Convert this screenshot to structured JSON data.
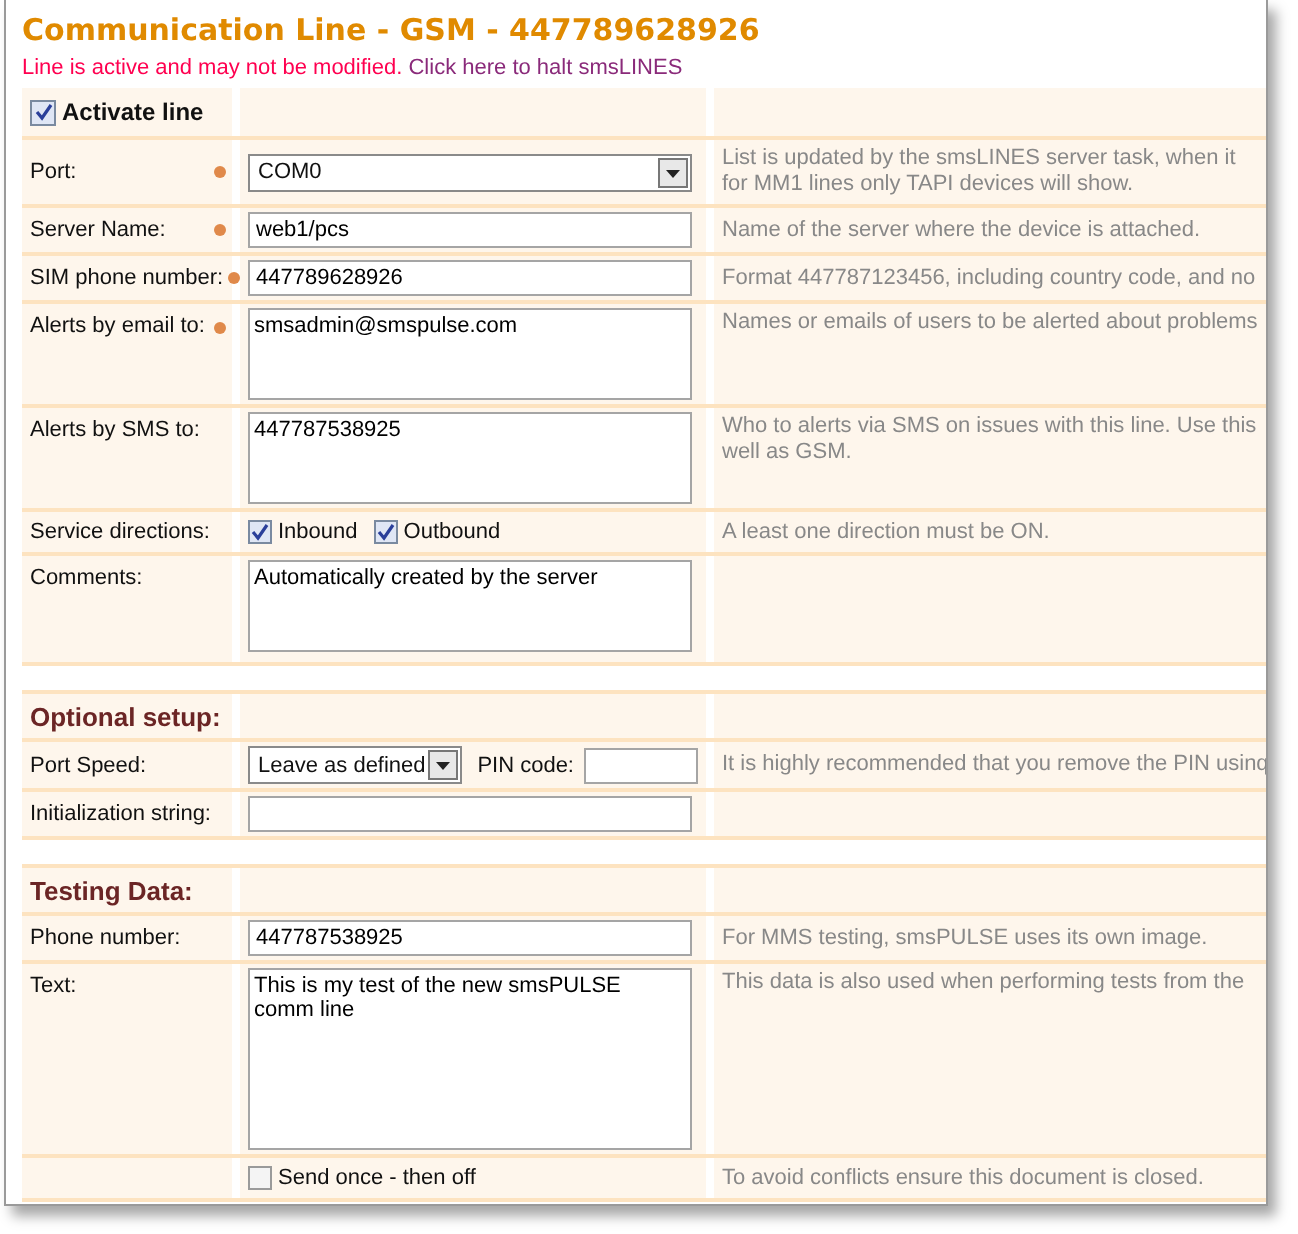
{
  "window": {
    "title": "Communication Line - GSM - 447789628926"
  },
  "status": {
    "warning": "Line is active and may not be modified.",
    "link": "Click here to halt smsLINES"
  },
  "activate": {
    "label": "Activate line",
    "checked": true
  },
  "rows": [
    {
      "kind": "select",
      "label": "Port:",
      "required": true,
      "value": "COM0",
      "help": "List is updated by the smsLINES server task, when it\nfor MM1 lines only TAPI devices will show."
    },
    {
      "kind": "text",
      "label": "Server Name:",
      "required": true,
      "value": "web1/pcs",
      "help": "Name of the server where the device is attached."
    },
    {
      "kind": "text",
      "label": "SIM phone number:",
      "required": true,
      "value": "447789628926",
      "help": "Format 447787123456, including country code, and no"
    },
    {
      "kind": "memo",
      "label": "Alerts by email to:",
      "required": true,
      "value": "smsadmin@smspulse.com",
      "help": "Names or emails of users to be alerted about problems"
    },
    {
      "kind": "memo",
      "label": "Alerts by SMS to:",
      "required": false,
      "value": "447787538925",
      "help": "Who to alerts via SMS on issues with this line. Use this\nwell as GSM."
    },
    {
      "kind": "checks",
      "label": "Service directions:",
      "required": false,
      "items": [
        {
          "label": "Inbound",
          "checked": true
        },
        {
          "label": "Outbound",
          "checked": true
        }
      ],
      "help": "A least one direction must be ON."
    },
    {
      "kind": "memo",
      "label": "Comments:",
      "required": false,
      "value": "Automatically created by the server"
    }
  ],
  "sections": [
    {
      "title": "Optional setup:",
      "rows": [
        {
          "kind": "speed",
          "label": "Port Speed:",
          "value": "Leave as defined",
          "pin_label": "PIN code:",
          "help": "It is highly recommended that you remove the PIN usinq"
        },
        {
          "kind": "text",
          "label": "Initialization string:"
        }
      ]
    },
    {
      "title": "Testing Data:",
      "rows": [
        {
          "kind": "text",
          "label": "Phone number:",
          "value": "447787538925",
          "help": "For MMS testing, smsPULSE uses its own image."
        },
        {
          "kind": "bigmemo",
          "label": "Text:",
          "value": "This is my test of the new smsPULSE comm line",
          "help": "This data is also used when performing tests from the"
        },
        {
          "kind": "check",
          "item": {
            "label": "Send once - then off",
            "checked": false
          },
          "help": "To avoid conflicts ensure this document is closed."
        }
      ]
    }
  ]
}
